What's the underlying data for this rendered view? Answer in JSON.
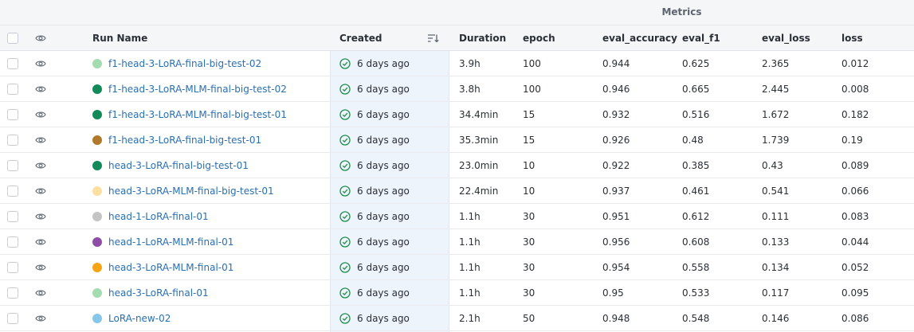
{
  "table": {
    "group_header": "Metrics",
    "columns": {
      "run_name": "Run Name",
      "created": "Created",
      "duration": "Duration",
      "epoch": "epoch",
      "eval_accuracy": "eval_accuracy",
      "eval_f1": "eval_f1",
      "eval_loss": "eval_loss",
      "loss": "loss"
    },
    "rows": [
      {
        "name": "f1-head-3-LoRA-final-big-test-02",
        "color": "#a3dcb1",
        "created": "6 days ago",
        "duration": "3.9h",
        "epoch": "100",
        "eval_accuracy": "0.944",
        "eval_f1": "0.625",
        "eval_loss": "2.365",
        "loss": "0.012"
      },
      {
        "name": "f1-head-3-LoRA-MLM-final-big-test-02",
        "color": "#138a5a",
        "created": "6 days ago",
        "duration": "3.8h",
        "epoch": "100",
        "eval_accuracy": "0.946",
        "eval_f1": "0.665",
        "eval_loss": "2.445",
        "loss": "0.008"
      },
      {
        "name": "f1-head-3-LoRA-MLM-final-big-test-01",
        "color": "#138a5a",
        "created": "6 days ago",
        "duration": "34.4min",
        "epoch": "15",
        "eval_accuracy": "0.932",
        "eval_f1": "0.516",
        "eval_loss": "1.672",
        "loss": "0.182"
      },
      {
        "name": "f1-head-3-LoRA-final-big-test-01",
        "color": "#b07a2a",
        "created": "6 days ago",
        "duration": "35.3min",
        "epoch": "15",
        "eval_accuracy": "0.926",
        "eval_f1": "0.48",
        "eval_loss": "1.739",
        "loss": "0.19"
      },
      {
        "name": "head-3-LoRA-final-big-test-01",
        "color": "#138a5a",
        "created": "6 days ago",
        "duration": "23.0min",
        "epoch": "10",
        "eval_accuracy": "0.922",
        "eval_f1": "0.385",
        "eval_loss": "0.43",
        "loss": "0.089"
      },
      {
        "name": "head-3-LoRA-MLM-final-big-test-01",
        "color": "#fbe0a2",
        "created": "6 days ago",
        "duration": "22.4min",
        "epoch": "10",
        "eval_accuracy": "0.937",
        "eval_f1": "0.461",
        "eval_loss": "0.541",
        "loss": "0.066"
      },
      {
        "name": "head-1-LoRA-final-01",
        "color": "#c4c4c4",
        "created": "6 days ago",
        "duration": "1.1h",
        "epoch": "30",
        "eval_accuracy": "0.951",
        "eval_f1": "0.612",
        "eval_loss": "0.111",
        "loss": "0.083"
      },
      {
        "name": "head-1-LoRA-MLM-final-01",
        "color": "#8f4ea6",
        "created": "6 days ago",
        "duration": "1.1h",
        "epoch": "30",
        "eval_accuracy": "0.956",
        "eval_f1": "0.608",
        "eval_loss": "0.133",
        "loss": "0.044"
      },
      {
        "name": "head-3-LoRA-MLM-final-01",
        "color": "#f5a514",
        "created": "6 days ago",
        "duration": "1.1h",
        "epoch": "30",
        "eval_accuracy": "0.954",
        "eval_f1": "0.558",
        "eval_loss": "0.134",
        "loss": "0.052"
      },
      {
        "name": "head-3-LoRA-final-01",
        "color": "#a3dcb1",
        "created": "6 days ago",
        "duration": "1.1h",
        "epoch": "30",
        "eval_accuracy": "0.95",
        "eval_f1": "0.533",
        "eval_loss": "0.117",
        "loss": "0.095"
      },
      {
        "name": "LoRA-new-02",
        "color": "#86c6e6",
        "created": "6 days ago",
        "duration": "2.1h",
        "epoch": "50",
        "eval_accuracy": "0.948",
        "eval_f1": "0.548",
        "eval_loss": "0.146",
        "loss": "0.086"
      }
    ]
  },
  "icons": {
    "visibility": "eye-icon",
    "created_status": "check-circle-icon",
    "sort": "sort-descending-icon"
  }
}
